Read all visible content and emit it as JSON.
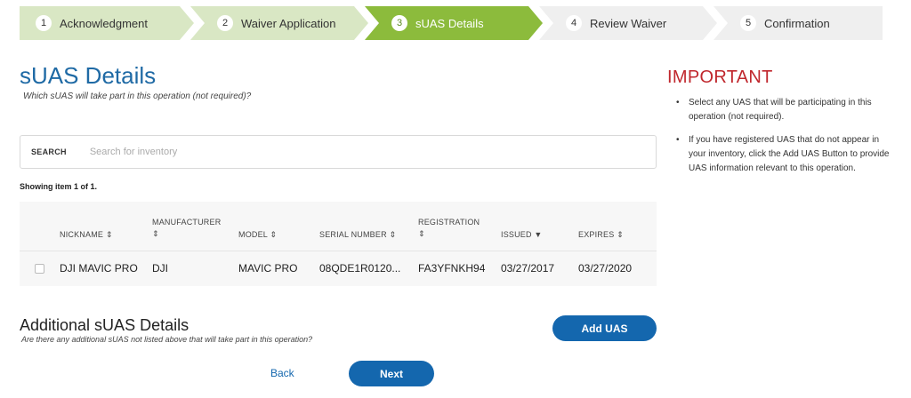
{
  "stepper": {
    "steps": [
      {
        "number": "1",
        "label": "Acknowledgment",
        "state": "completed"
      },
      {
        "number": "2",
        "label": "Waiver Application",
        "state": "completed"
      },
      {
        "number": "3",
        "label": "sUAS Details",
        "state": "active"
      },
      {
        "number": "4",
        "label": "Review Waiver",
        "state": "pending"
      },
      {
        "number": "5",
        "label": "Confirmation",
        "state": "pending"
      }
    ],
    "colors": {
      "completed": "#d9e7c4",
      "active": "#8cbb3c",
      "pending": "#efefef"
    }
  },
  "main": {
    "title": "sUAS Details",
    "subtitle": "Which sUAS will take part in this operation (not required)?"
  },
  "search": {
    "label": "SEARCH",
    "placeholder": "Search for inventory",
    "value": ""
  },
  "showing": {
    "prefix": "Showing item ",
    "range": "1 of 1",
    "suffix": "."
  },
  "table": {
    "headers": [
      {
        "line1": "NICKNAME",
        "line2": "",
        "sort_icon": "sort-icon"
      },
      {
        "line1": "MANUFACTURER",
        "line2": "",
        "sort_icon": "sort-icon"
      },
      {
        "line1": "MODEL",
        "line2": "",
        "sort_icon": "sort-icon"
      },
      {
        "line1": "SERIAL NUMBER",
        "line2": "",
        "sort_icon": "sort-icon"
      },
      {
        "line1": "REGISTRATION",
        "line2": "",
        "sort_icon": "sort-icon"
      },
      {
        "line1": "ISSUED",
        "line2": "",
        "sort_icon": "sort-desc-icon"
      },
      {
        "line1": "EXPIRES",
        "line2": "",
        "sort_icon": "sort-icon"
      }
    ],
    "rows": [
      {
        "checked": false,
        "nickname": "DJI MAVIC PRO",
        "manufacturer": "DJI",
        "model": "MAVIC PRO",
        "serial_number": "08QDE1R0120...",
        "registration": "FA3YFNKH94",
        "issued": "03/27/2017",
        "expires": "03/27/2020"
      }
    ]
  },
  "additional": {
    "title": "Additional sUAS Details",
    "subtitle": "Are there any additional sUAS not listed above that will take part in this operation?",
    "add_button": "Add UAS"
  },
  "footer": {
    "back_label": "Back",
    "next_label": "Next"
  },
  "important": {
    "title": "IMPORTANT",
    "items": [
      "Select any UAS that will be participating in this operation (not required).",
      "If you have registered UAS that do not appear in your inventory, click the Add UAS Button to provide UAS information relevant to this operation."
    ]
  },
  "colors": {
    "accent_blue": "#1467ae",
    "title_blue": "#1f6aa5",
    "important_red": "#c0272d"
  }
}
